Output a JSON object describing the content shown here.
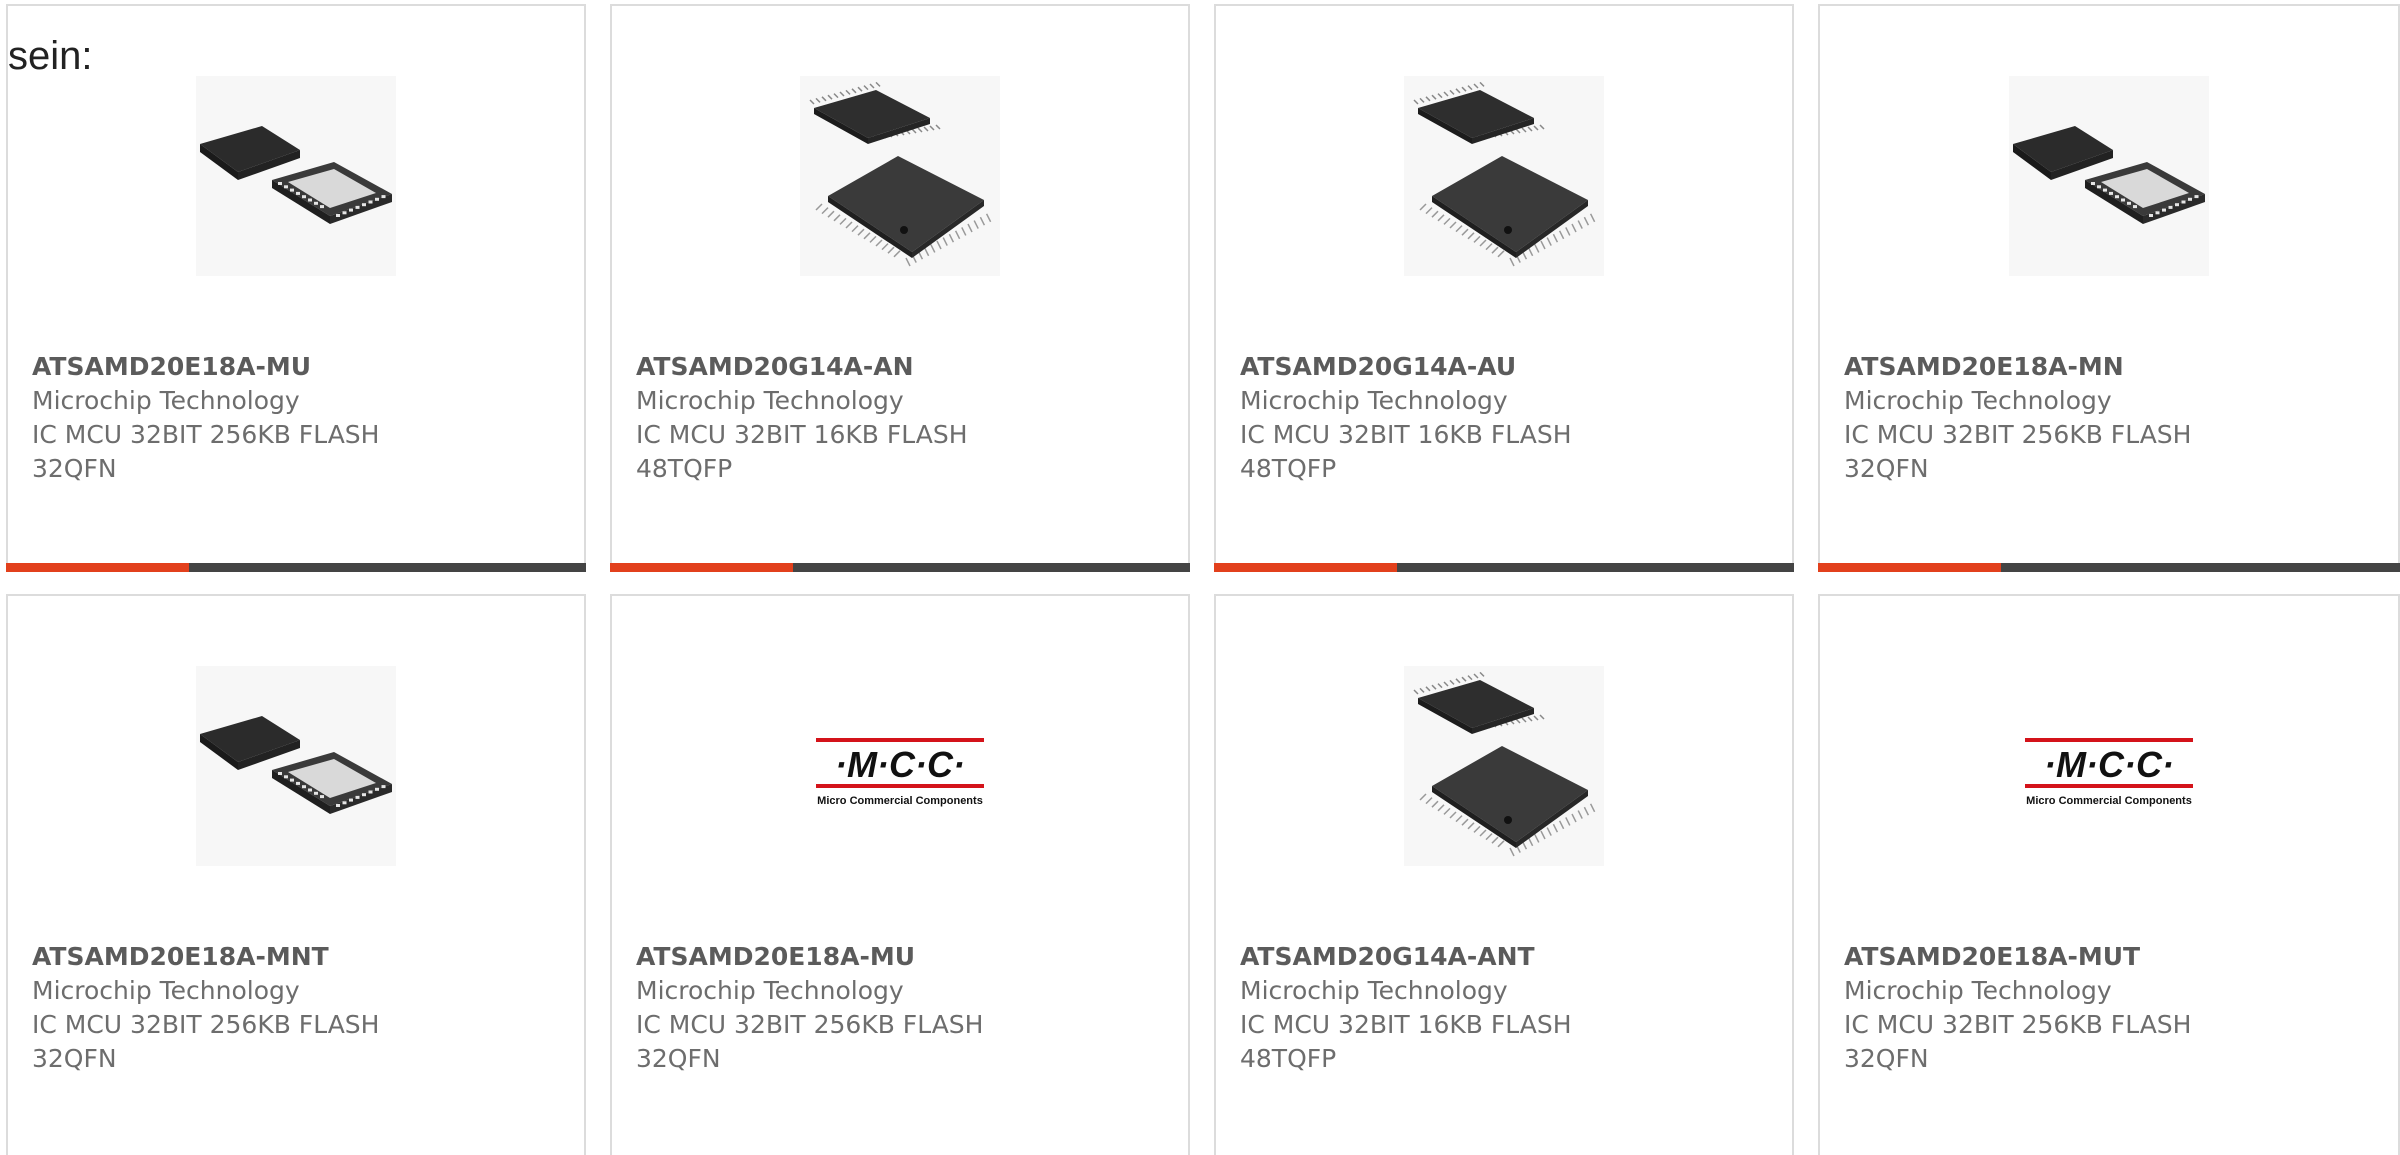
{
  "intro_text": "sein:",
  "colors": {
    "accent": "#e2401c",
    "bar": "#444444",
    "card_border": "#dcdcdc",
    "text": "#6d6d6d"
  },
  "products": [
    {
      "part": "ATSAMD20E18A-MU",
      "manufacturer": "Microchip Technology",
      "desc_line1": "IC MCU 32BIT 256KB FLASH",
      "desc_line2": "32QFN",
      "image": "qfn-chip-icon"
    },
    {
      "part": "ATSAMD20G14A-AN",
      "manufacturer": "Microchip Technology",
      "desc_line1": "IC MCU 32BIT 16KB FLASH",
      "desc_line2": "48TQFP",
      "image": "tqfp-chip-icon"
    },
    {
      "part": "ATSAMD20G14A-AU",
      "manufacturer": "Microchip Technology",
      "desc_line1": "IC MCU 32BIT 16KB FLASH",
      "desc_line2": "48TQFP",
      "image": "tqfp-chip-icon"
    },
    {
      "part": "ATSAMD20E18A-MN",
      "manufacturer": "Microchip Technology",
      "desc_line1": "IC MCU 32BIT 256KB FLASH",
      "desc_line2": "32QFN",
      "image": "qfn-chip-icon"
    },
    {
      "part": "ATSAMD20E18A-MNT",
      "manufacturer": "Microchip Technology",
      "desc_line1": "IC MCU 32BIT 256KB FLASH",
      "desc_line2": "32QFN",
      "image": "qfn-chip-icon"
    },
    {
      "part": "ATSAMD20E18A-MU",
      "manufacturer": "Microchip Technology",
      "desc_line1": "IC MCU 32BIT 256KB FLASH",
      "desc_line2": "32QFN",
      "image": "mcc-logo"
    },
    {
      "part": "ATSAMD20G14A-ANT",
      "manufacturer": "Microchip Technology",
      "desc_line1": "IC MCU 32BIT 16KB FLASH",
      "desc_line2": "48TQFP",
      "image": "tqfp-chip-icon"
    },
    {
      "part": "ATSAMD20E18A-MUT",
      "manufacturer": "Microchip Technology",
      "desc_line1": "IC MCU 32BIT 256KB FLASH",
      "desc_line2": "32QFN",
      "image": "mcc-logo"
    }
  ],
  "mcc_logo": {
    "letters": "·M·C·C·",
    "tagline": "Micro Commercial Components"
  }
}
